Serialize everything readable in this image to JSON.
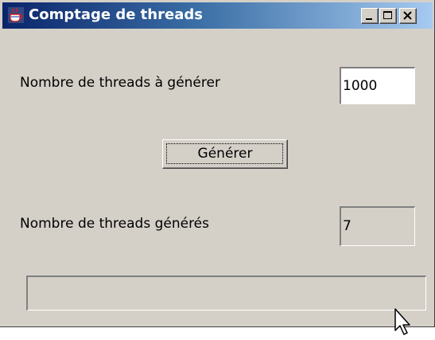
{
  "window": {
    "title": "Comptage de threads",
    "icon": "java-cup-icon",
    "controls": {
      "minimize": "minimize-icon",
      "maximize": "maximize-icon",
      "close": "close-icon"
    }
  },
  "form": {
    "count_label": "Nombre de threads à générer",
    "count_value": "1000",
    "generate_button": "Générer",
    "generated_label": "Nombre de threads générés",
    "generated_value": "7",
    "progress": 0.0
  },
  "colors": {
    "titlebar_start": "#0a246a",
    "titlebar_end": "#a6caf0",
    "face": "#d4d0c8"
  }
}
